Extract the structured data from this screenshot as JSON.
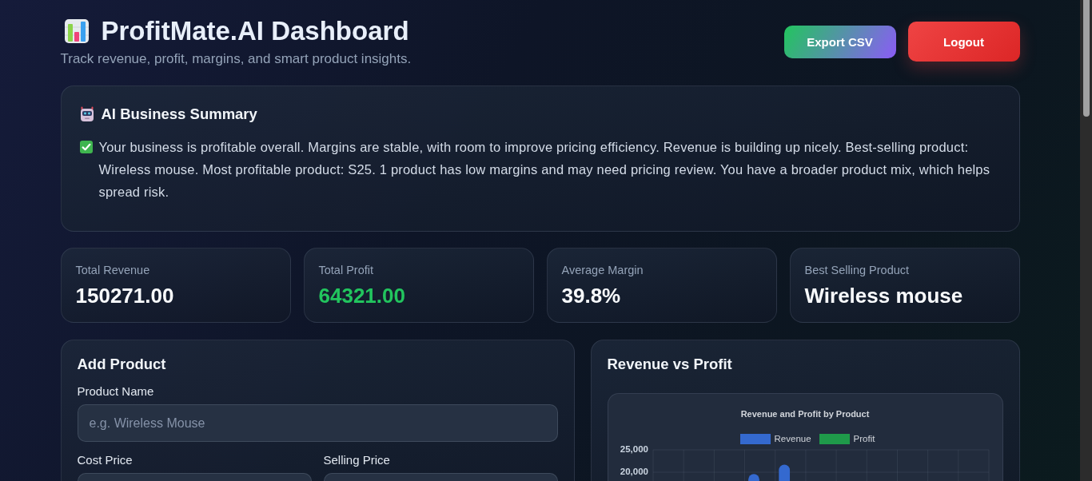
{
  "header": {
    "title": "ProfitMate.AI Dashboard",
    "subtitle": "Track revenue, profit, margins, and smart product insights.",
    "buttons": [
      {
        "label": "Export CSV",
        "kind": "export"
      },
      {
        "label": "Logout",
        "kind": "logout"
      }
    ]
  },
  "summary": {
    "title": "AI Business Summary",
    "text": "Your business is profitable overall. Margins are stable, with room to improve pricing efficiency. Revenue is building up nicely. Best-selling product: Wireless mouse. Most profitable product: S25. 1 product has low margins and may need pricing review. You have a broader product mix, which helps spread risk."
  },
  "stats": [
    {
      "label": "Total Revenue",
      "value": "150271.00",
      "kind": "plain"
    },
    {
      "label": "Total Profit",
      "value": "64321.00",
      "kind": "positive"
    },
    {
      "label": "Average Margin",
      "value": "39.8%",
      "kind": "plain"
    },
    {
      "label": "Best Selling Product",
      "value": "Wireless mouse",
      "kind": "plain"
    }
  ],
  "add_product": {
    "title": "Add Product",
    "field_rows": [
      {
        "fields": [
          {
            "label": "Product Name",
            "placeholder": "e.g. Wireless Mouse"
          }
        ]
      },
      {
        "fields": [
          {
            "label": "Cost Price"
          },
          {
            "label": "Selling Price"
          }
        ]
      }
    ]
  },
  "revenue_chart": {
    "title": "Revenue vs Profit",
    "chart_data": {
      "type": "bar",
      "title": "Revenue and Profit by Product",
      "ylim": [
        0,
        25000
      ],
      "yticks": [
        {
          "value": 20000,
          "label": "20,000"
        },
        {
          "value": 25000,
          "label": "25,000"
        }
      ],
      "series": [
        {
          "name": "Revenue",
          "color": "#3469cf",
          "values": [
            null,
            null,
            null,
            19600,
            21700,
            null,
            null,
            null,
            null,
            null,
            null
          ]
        },
        {
          "name": "Profit",
          "color": "#1f9a4a",
          "values": [
            null,
            null,
            null,
            null,
            null,
            null,
            null,
            null,
            null,
            null,
            null
          ]
        }
      ]
    }
  }
}
